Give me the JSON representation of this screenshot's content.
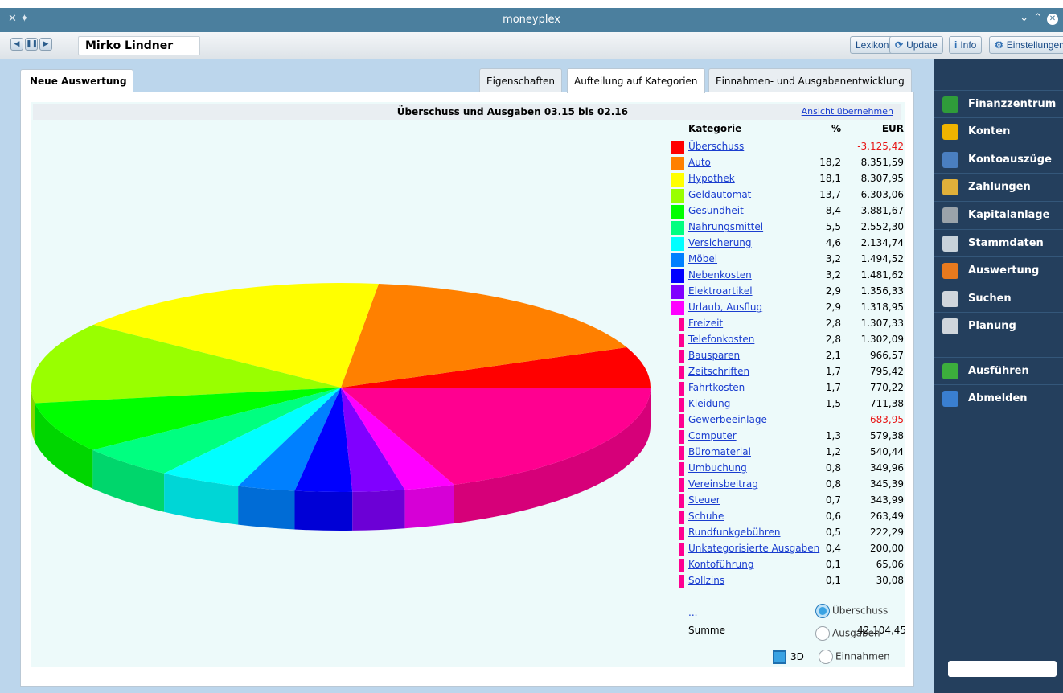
{
  "window": {
    "title": "moneyplex"
  },
  "toolbar": {
    "user": "Mirko Lindner",
    "buttons": [
      {
        "label": "Lexikon",
        "icon": ""
      },
      {
        "label": "Update",
        "icon": "update-icon"
      },
      {
        "label": "Info",
        "icon": "info-icon"
      },
      {
        "label": "Einstellungen",
        "icon": "gear-icon"
      }
    ]
  },
  "tabs": {
    "left": "Neue Auswertung",
    "sub": [
      "Eigenschaften",
      "Aufteilung auf Kategorien",
      "Einnahmen- und Ausgabenentwicklung"
    ],
    "active_sub": 1
  },
  "chart_header": {
    "title": "Überschuss und Ausgaben  03.15 bis 02.16",
    "link": "Ansicht übernehmen"
  },
  "legend": {
    "head_category": "Kategorie",
    "head_percent": "%",
    "head_eur": "EUR",
    "more": "...",
    "summe_label": "Summe",
    "summe_value": "42.104,45"
  },
  "chart_data": {
    "type": "pie",
    "three_d": true,
    "slices": [
      {
        "name": "Überschuss",
        "percent": null,
        "value": -3125.42,
        "display": "-3.125,42",
        "color": "#ff0000"
      },
      {
        "name": "Auto",
        "percent": "18,2",
        "value": 8351.59,
        "display": "8.351,59",
        "color": "#ff8000"
      },
      {
        "name": "Hypothek",
        "percent": "18,1",
        "value": 8307.95,
        "display": "8.307,95",
        "color": "#ffff00"
      },
      {
        "name": "Geldautomat",
        "percent": "13,7",
        "value": 6303.06,
        "display": "6.303,06",
        "color": "#99ff00"
      },
      {
        "name": "Gesundheit",
        "percent": "8,4",
        "value": 3881.67,
        "display": "3.881,67",
        "color": "#00ff00"
      },
      {
        "name": "Nahrungsmittel",
        "percent": "5,5",
        "value": 2552.3,
        "display": "2.552,30",
        "color": "#00ff80"
      },
      {
        "name": "Versicherung",
        "percent": "4,6",
        "value": 2134.74,
        "display": "2.134,74",
        "color": "#00ffff"
      },
      {
        "name": "Möbel",
        "percent": "3,2",
        "value": 1494.52,
        "display": "1.494,52",
        "color": "#0080ff"
      },
      {
        "name": "Nebenkosten",
        "percent": "3,2",
        "value": 1481.62,
        "display": "1.481,62",
        "color": "#0000ff"
      },
      {
        "name": "Elektroartikel",
        "percent": "2,9",
        "value": 1356.33,
        "display": "1.356,33",
        "color": "#8000ff"
      },
      {
        "name": "Urlaub, Ausflug",
        "percent": "2,9",
        "value": 1318.95,
        "display": "1.318,95",
        "color": "#ff00ff"
      },
      {
        "name": "Freizeit",
        "percent": "2,8",
        "value": 1307.33,
        "display": "1.307,33",
        "color": "#ff0090"
      },
      {
        "name": "Telefonkosten",
        "percent": "2,8",
        "value": 1302.09,
        "display": "1.302,09",
        "color": "#ff0090"
      },
      {
        "name": "Bausparen",
        "percent": "2,1",
        "value": 966.57,
        "display": "966,57",
        "color": "#ff0090"
      },
      {
        "name": "Zeitschriften",
        "percent": "1,7",
        "value": 795.42,
        "display": "795,42",
        "color": "#ff0090"
      },
      {
        "name": "Fahrtkosten",
        "percent": "1,7",
        "value": 770.22,
        "display": "770,22",
        "color": "#ff0090"
      },
      {
        "name": "Kleidung",
        "percent": "1,5",
        "value": 711.38,
        "display": "711,38",
        "color": "#ff0090"
      },
      {
        "name": "Gewerbeeinlage",
        "percent": null,
        "value": -683.95,
        "display": "-683,95",
        "color": "#ff0090"
      },
      {
        "name": "Computer",
        "percent": "1,3",
        "value": 579.38,
        "display": "579,38",
        "color": "#ff0090"
      },
      {
        "name": "Büromaterial",
        "percent": "1,2",
        "value": 540.44,
        "display": "540,44",
        "color": "#ff0090"
      },
      {
        "name": "Umbuchung",
        "percent": "0,8",
        "value": 349.96,
        "display": "349,96",
        "color": "#ff0090"
      },
      {
        "name": "Vereinsbeitrag",
        "percent": "0,8",
        "value": 345.39,
        "display": "345,39",
        "color": "#ff0090"
      },
      {
        "name": "Steuer",
        "percent": "0,7",
        "value": 343.99,
        "display": "343,99",
        "color": "#ff0090"
      },
      {
        "name": "Schuhe",
        "percent": "0,6",
        "value": 263.49,
        "display": "263,49",
        "color": "#ff0090"
      },
      {
        "name": "Rundfunkgebühren",
        "percent": "0,5",
        "value": 222.29,
        "display": "222,29",
        "color": "#ff0090"
      },
      {
        "name": "Unkategorisierte Ausgaben",
        "percent": "0,4",
        "value": 200.0,
        "display": "200,00",
        "color": "#ff0090"
      },
      {
        "name": "Kontoführung",
        "percent": "0,1",
        "value": 65.06,
        "display": "65,06",
        "color": "#ff0090"
      },
      {
        "name": "Sollzins",
        "percent": "0,1",
        "value": 30.08,
        "display": "30,08",
        "color": "#ff0090"
      }
    ]
  },
  "options": {
    "radio": [
      "Überschuss",
      "Ausgaben",
      "Einnahmen"
    ],
    "selected": "Überschuss",
    "checkbox_3d": "3D"
  },
  "sidebar": {
    "items": [
      {
        "label": "Finanzzentrum",
        "icon": "chart-line-icon",
        "color": "#2f9c3a"
      },
      {
        "label": "Konten",
        "icon": "wallet-icon",
        "color": "#f0b400"
      },
      {
        "label": "Kontoauszüge",
        "icon": "statements-icon",
        "color": "#4a7fc0"
      },
      {
        "label": "Zahlungen",
        "icon": "payments-icon",
        "color": "#e0b03a"
      },
      {
        "label": "Kapitalanlage",
        "icon": "safe-icon",
        "color": "#9aa3aa"
      },
      {
        "label": "Stammdaten",
        "icon": "document-icon",
        "color": "#c8d2da"
      },
      {
        "label": "Auswertung",
        "icon": "pie-chart-icon",
        "color": "#e87a1e"
      },
      {
        "label": "Suchen",
        "icon": "search-icon",
        "color": "#d0d6dc"
      },
      {
        "label": "Planung",
        "icon": "clock-icon",
        "color": "#d0d6dc"
      },
      {
        "label": "Ausführen",
        "icon": "refresh-icon",
        "color": "#3cae3c"
      },
      {
        "label": "Abmelden",
        "icon": "exit-icon",
        "color": "#3a7fd0"
      }
    ]
  }
}
